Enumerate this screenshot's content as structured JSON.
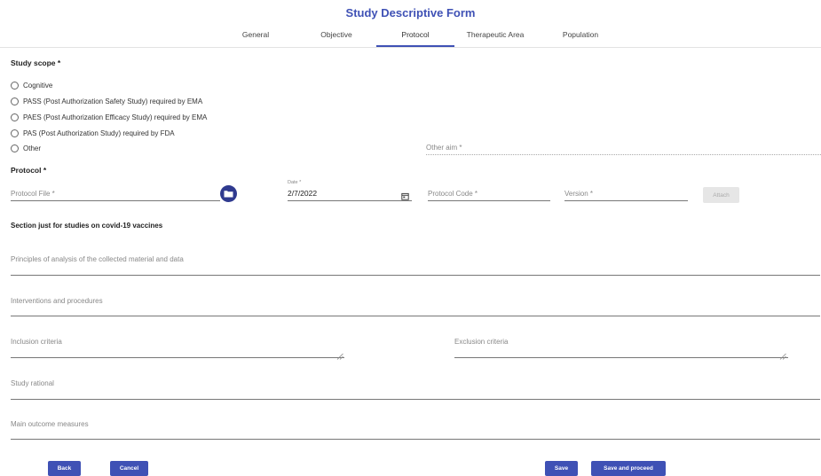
{
  "page": {
    "title": "Study Descriptive Form"
  },
  "tabs": [
    {
      "label": "General"
    },
    {
      "label": "Objective"
    },
    {
      "label": "Protocol"
    },
    {
      "label": "Therapeutic Area"
    },
    {
      "label": "Population"
    }
  ],
  "active_tab": "Protocol",
  "study_scope": {
    "label": "Study scope *",
    "options": [
      {
        "label": "Cognitive"
      },
      {
        "label": "PASS (Post Authorization Safety Study) required by EMA"
      },
      {
        "label": "PAES (Post Authorization Efficacy Study) required by EMA"
      },
      {
        "label": "PAS (Post Authorization Study) required by FDA"
      },
      {
        "label": "Other"
      }
    ],
    "other_aim_placeholder": "Other aim *"
  },
  "protocol": {
    "label": "Protocol *",
    "file_placeholder": "Protocol File *",
    "date_label": "Date *",
    "date_value": "2/7/2022",
    "code_placeholder": "Protocol Code *",
    "version_placeholder": "Version *",
    "attach_label": "Attach"
  },
  "covid": {
    "label": "Section just for studies on covid-19 vaccines",
    "principles_placeholder": "Principles of analysis of the collected material and data",
    "interventions_placeholder": "Interventions and procedures",
    "inclusion_placeholder": "Inclusion criteria",
    "exclusion_placeholder": "Exclusion criteria",
    "rational_placeholder": "Study rational",
    "outcome_placeholder": "Main outcome measures"
  },
  "actions": {
    "back": "Back",
    "cancel": "Cancel",
    "save": "Save",
    "save_proceed": "Save and proceed"
  },
  "colors": {
    "primary": "#3f51b5",
    "folder_button": "#2f3a8f"
  }
}
